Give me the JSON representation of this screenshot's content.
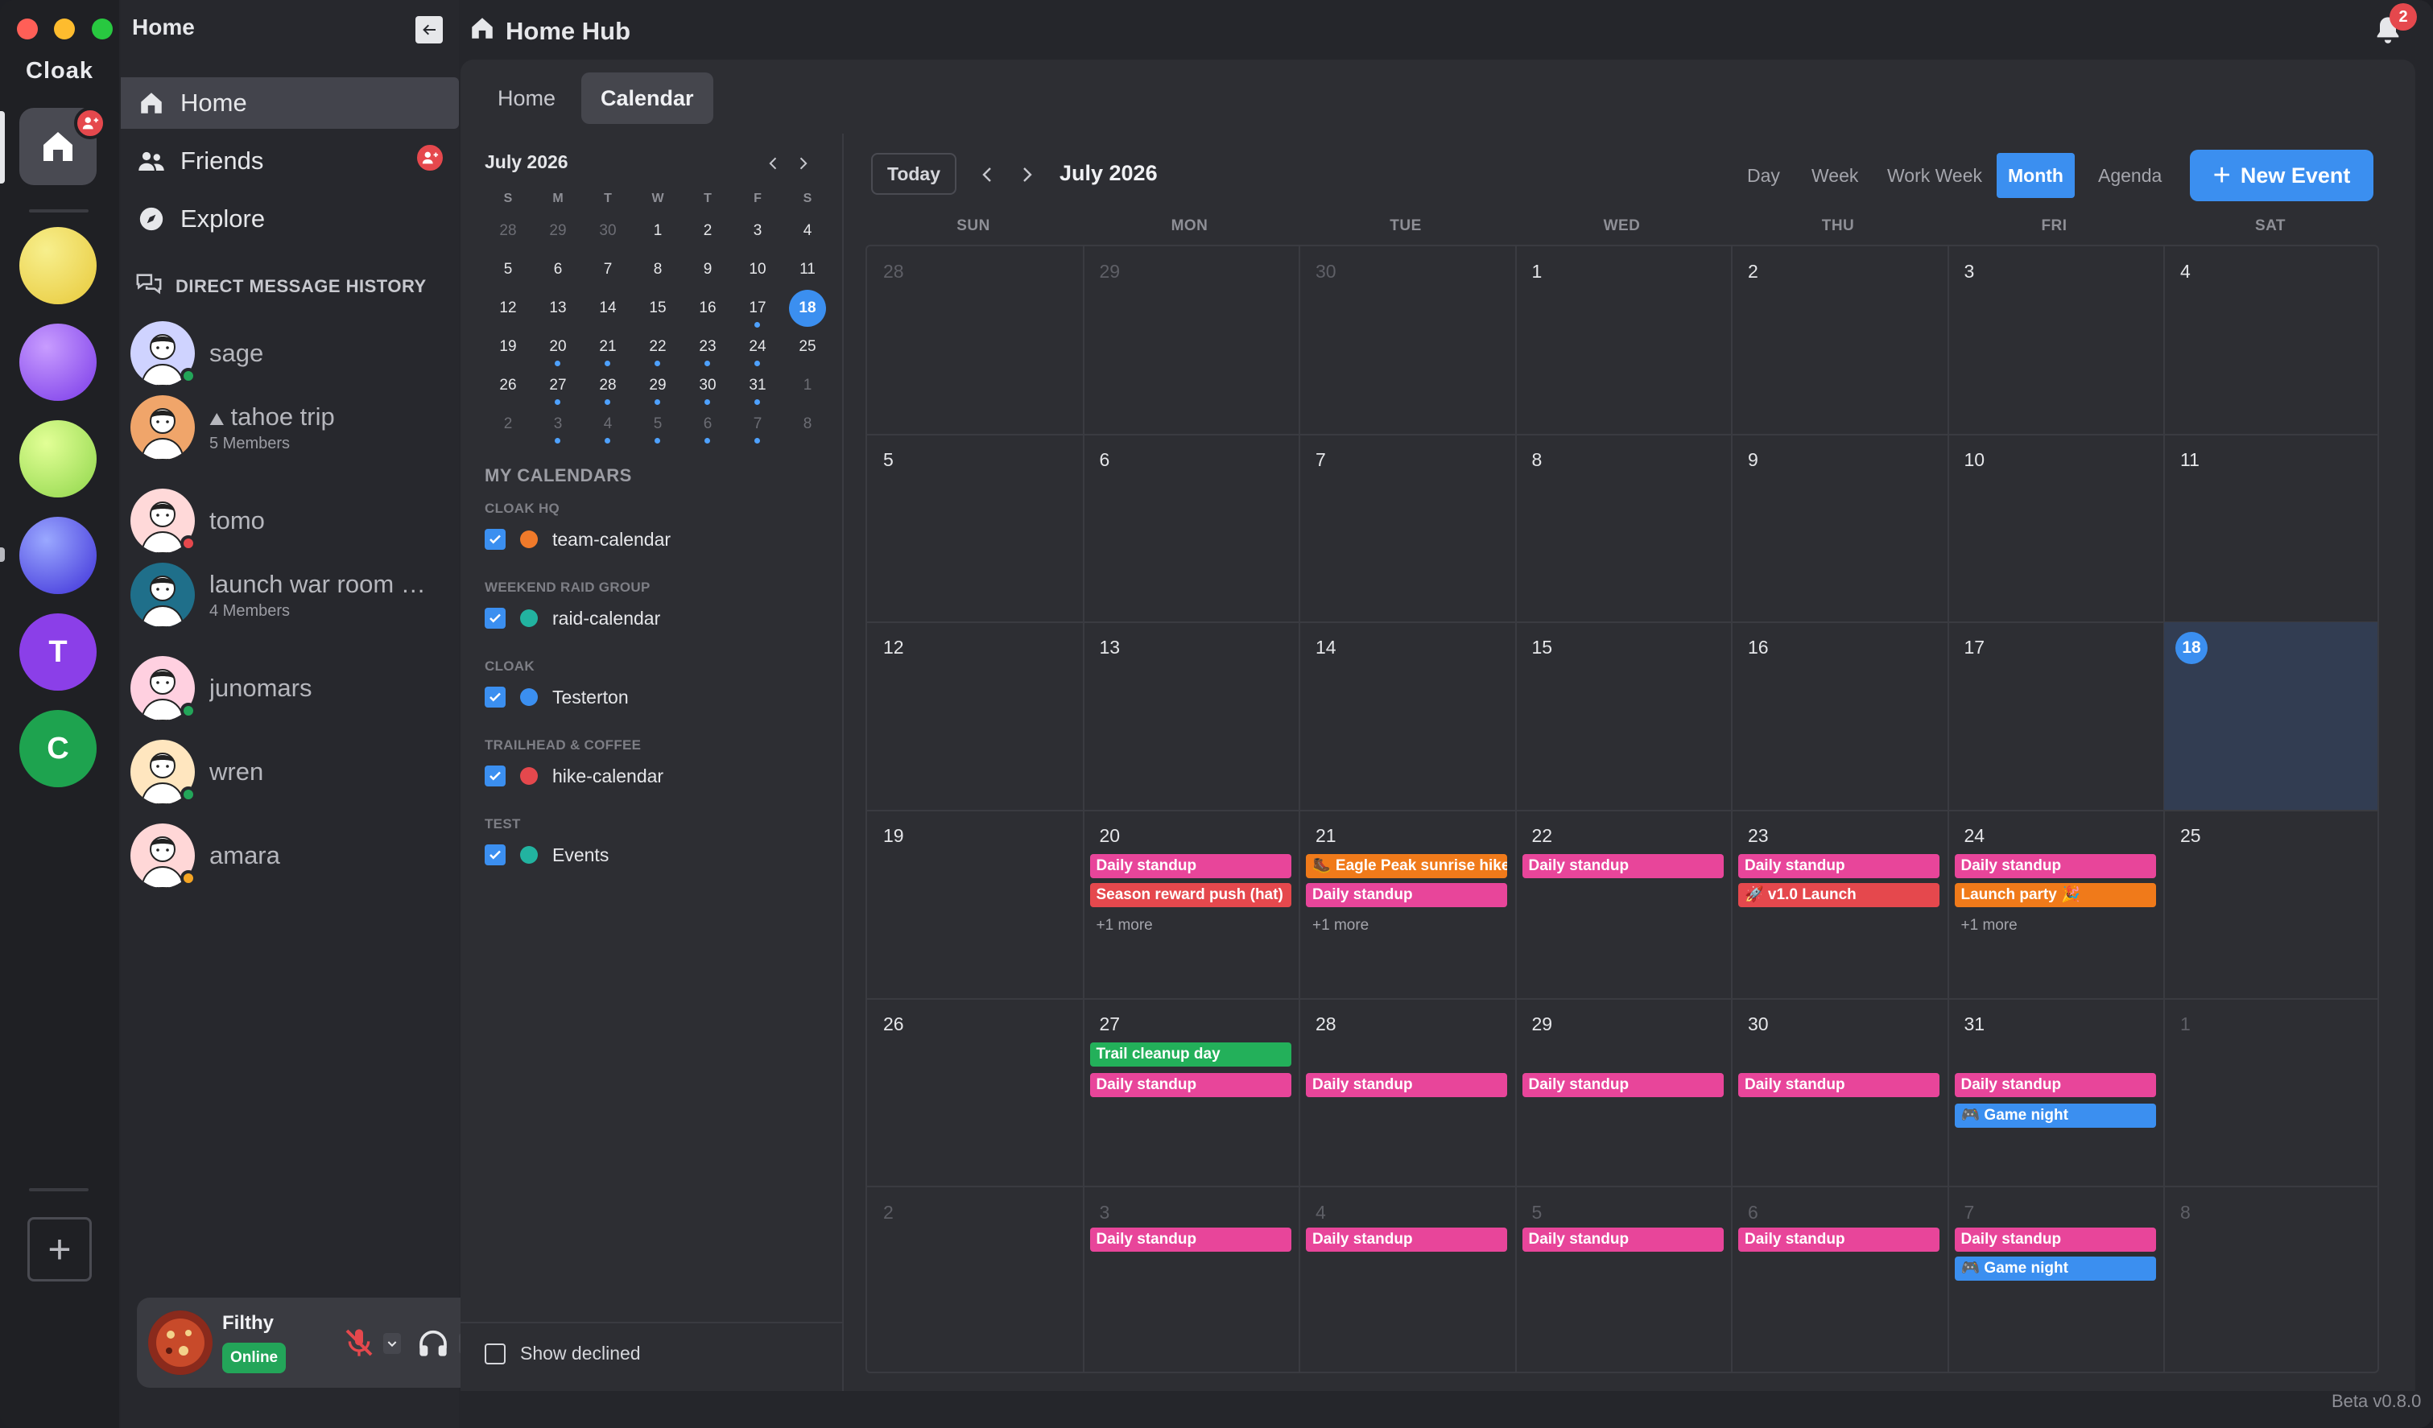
{
  "rail": {
    "brand": "Cloak",
    "servers": [
      {
        "type": "gradient",
        "colors": [
          "#f7ef8d",
          "#e8c93a"
        ]
      },
      {
        "type": "gradient",
        "colors": [
          "#c89cff",
          "#7a3ae8"
        ]
      },
      {
        "type": "gradient",
        "colors": [
          "#e2ff96",
          "#8fd64a"
        ]
      },
      {
        "type": "gradient",
        "colors": [
          "#9aa8ff",
          "#3d2fd8"
        ]
      },
      {
        "type": "letter",
        "letter": "T",
        "color": "#8b3fe8"
      },
      {
        "type": "letter",
        "letter": "C",
        "color": "#1ea34f"
      }
    ]
  },
  "sidebar": {
    "title": "Home",
    "nav": [
      {
        "label": "Home",
        "icon": "home-icon"
      },
      {
        "label": "Friends",
        "icon": "friends-icon"
      },
      {
        "label": "Explore",
        "icon": "compass-icon"
      }
    ],
    "dm_header": "DIRECT MESSAGE HISTORY",
    "dms": [
      {
        "name": "sage",
        "sub": "",
        "presence": "#23a559",
        "bg": "#cfd3ff"
      },
      {
        "name": "tahoe trip",
        "sub": "5 Members",
        "presence": "",
        "bg": "#f0a56a",
        "prefix": "⛰"
      },
      {
        "name": "tomo",
        "sub": "",
        "presence": "#e5484d",
        "bg": "#ffd9d9"
      },
      {
        "name": "launch war room …",
        "sub": "4 Members",
        "presence": "",
        "bg": "#1f6f8a"
      },
      {
        "name": "junomars",
        "sub": "",
        "presence": "#23a559",
        "bg": "#ffd0e0"
      },
      {
        "name": "wren",
        "sub": "",
        "presence": "#23a559",
        "bg": "#ffe6bf"
      },
      {
        "name": "amara",
        "sub": "",
        "presence": "#f5a524",
        "bg": "#ffd7d7"
      }
    ],
    "user": {
      "name": "Filthy",
      "status": "Online"
    }
  },
  "header": {
    "title": "Home Hub",
    "notifications": "2",
    "version": "Beta v0.8.0"
  },
  "tabs": [
    {
      "label": "Home"
    },
    {
      "label": "Calendar"
    }
  ],
  "mini": {
    "title": "July 2026",
    "dow": [
      "S",
      "M",
      "T",
      "W",
      "T",
      "F",
      "S"
    ],
    "weeks": [
      [
        "28",
        "29",
        "30",
        "1",
        "2",
        "3",
        "4"
      ],
      [
        "5",
        "6",
        "7",
        "8",
        "9",
        "10",
        "11"
      ],
      [
        "12",
        "13",
        "14",
        "15",
        "16",
        "17",
        "18"
      ],
      [
        "19",
        "20",
        "21",
        "22",
        "23",
        "24",
        "25"
      ],
      [
        "26",
        "27",
        "28",
        "29",
        "30",
        "31",
        "1"
      ],
      [
        "2",
        "3",
        "4",
        "5",
        "6",
        "7",
        "8"
      ]
    ]
  },
  "calendars": {
    "title": "MY CALENDARS",
    "groups": [
      {
        "group": "CLOAK HQ",
        "name": "team-calendar",
        "color": "#f07a2a"
      },
      {
        "group": "WEEKEND RAID GROUP",
        "name": "raid-calendar",
        "color": "#22b3a0"
      },
      {
        "group": "CLOAK",
        "name": "Testerton",
        "color": "#3b8ff0"
      },
      {
        "group": "TRAILHEAD & COFFEE",
        "name": "hike-calendar",
        "color": "#e5484d"
      },
      {
        "group": "TEST",
        "name": "Events",
        "color": "#22b3a0"
      }
    ],
    "show_declined": "Show declined"
  },
  "toolbar": {
    "today": "Today",
    "title": "July 2026",
    "views": [
      "Day",
      "Week",
      "Work Week",
      "Month",
      "Agenda"
    ],
    "active_view": "Month",
    "new_event": "New Event"
  },
  "month": {
    "dow": [
      "SUN",
      "MON",
      "TUE",
      "WED",
      "THU",
      "FRI",
      "SAT"
    ],
    "weeks": [
      [
        {
          "d": "28",
          "dim": true
        },
        {
          "d": "29",
          "dim": true
        },
        {
          "d": "30",
          "dim": true
        },
        {
          "d": "1"
        },
        {
          "d": "2"
        },
        {
          "d": "3"
        },
        {
          "d": "4"
        }
      ],
      [
        {
          "d": "5"
        },
        {
          "d": "6"
        },
        {
          "d": "7"
        },
        {
          "d": "8"
        },
        {
          "d": "9"
        },
        {
          "d": "10"
        },
        {
          "d": "11"
        }
      ],
      [
        {
          "d": "12"
        },
        {
          "d": "13"
        },
        {
          "d": "14"
        },
        {
          "d": "15"
        },
        {
          "d": "16"
        },
        {
          "d": "17"
        },
        {
          "d": "18",
          "today": true
        }
      ],
      [
        {
          "d": "19"
        },
        {
          "d": "20",
          "events": [
            {
              "t": "Daily standup",
              "c": "#e8459a"
            },
            {
              "t": "Season reward push (hat)",
              "c": "#e5484d"
            }
          ],
          "more": "+1 more"
        },
        {
          "d": "21",
          "events": [
            {
              "t": "🥾 Eagle Peak sunrise hike",
              "c": "#f07a1a"
            },
            {
              "t": "Daily standup",
              "c": "#e8459a"
            }
          ],
          "more": "+1 more"
        },
        {
          "d": "22",
          "events": [
            {
              "t": "Daily standup",
              "c": "#e8459a"
            }
          ]
        },
        {
          "d": "23",
          "events": [
            {
              "t": "Daily standup",
              "c": "#e8459a"
            },
            {
              "t": "🚀 v1.0 Launch",
              "c": "#e5484d"
            }
          ]
        },
        {
          "d": "24",
          "events": [
            {
              "t": "Daily standup",
              "c": "#e8459a"
            },
            {
              "t": "Launch party 🎉",
              "c": "#f07a1a"
            }
          ],
          "more": "+1 more"
        },
        {
          "d": "25"
        }
      ],
      [
        {
          "d": "26"
        },
        {
          "d": "27",
          "events": [
            {
              "t": "Trail cleanup day",
              "c": "#23b05a"
            },
            {
              "t": "Daily standup",
              "c": "#e8459a"
            }
          ]
        },
        {
          "d": "28",
          "events": [
            {
              "t": "Daily standup",
              "c": "#e8459a",
              "slot": 1
            }
          ]
        },
        {
          "d": "29",
          "events": [
            {
              "t": "Daily standup",
              "c": "#e8459a",
              "slot": 1
            }
          ]
        },
        {
          "d": "30",
          "events": [
            {
              "t": "Daily standup",
              "c": "#e8459a",
              "slot": 1
            }
          ]
        },
        {
          "d": "31",
          "events": [
            {
              "t": "Daily standup",
              "c": "#e8459a",
              "slot": 1
            },
            {
              "t": "🎮 Game night",
              "c": "#3b8ff0",
              "slot": 2
            }
          ]
        },
        {
          "d": "1",
          "dim": true
        }
      ],
      [
        {
          "d": "2",
          "dim": true
        },
        {
          "d": "3",
          "dim": true,
          "events": [
            {
              "t": "Daily standup",
              "c": "#e8459a"
            }
          ]
        },
        {
          "d": "4",
          "dim": true,
          "events": [
            {
              "t": "Daily standup",
              "c": "#e8459a"
            }
          ]
        },
        {
          "d": "5",
          "dim": true,
          "events": [
            {
              "t": "Daily standup",
              "c": "#e8459a"
            }
          ]
        },
        {
          "d": "6",
          "dim": true,
          "events": [
            {
              "t": "Daily standup",
              "c": "#e8459a"
            }
          ]
        },
        {
          "d": "7",
          "dim": true,
          "events": [
            {
              "t": "Daily standup",
              "c": "#e8459a"
            },
            {
              "t": "🎮 Game night",
              "c": "#3b8ff0"
            }
          ]
        },
        {
          "d": "8",
          "dim": true
        }
      ]
    ]
  }
}
